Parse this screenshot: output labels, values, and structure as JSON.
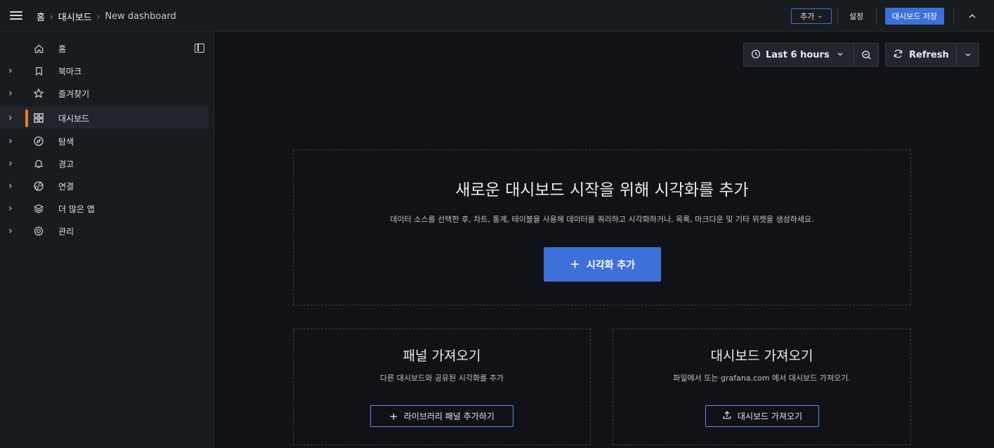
{
  "topbar": {
    "breadcrumbs": [
      "홈",
      "대시보드",
      "New dashboard"
    ],
    "add_label": "추가",
    "settings_label": "설정",
    "save_label": "대시보드 저장"
  },
  "sidebar": {
    "items": [
      {
        "label": "홈",
        "icon": "home-icon"
      },
      {
        "label": "북마크",
        "icon": "bookmark-icon"
      },
      {
        "label": "즐겨찾기",
        "icon": "star-icon"
      },
      {
        "label": "대시보드",
        "icon": "dashboard-grid-icon",
        "active": true
      },
      {
        "label": "탐색",
        "icon": "compass-icon"
      },
      {
        "label": "경고",
        "icon": "bell-icon"
      },
      {
        "label": "연결",
        "icon": "link-icon"
      },
      {
        "label": "더 많은 앱",
        "icon": "layers-icon"
      },
      {
        "label": "관리",
        "icon": "cog-icon"
      }
    ]
  },
  "toolbar": {
    "time_range": "Last 6 hours",
    "refresh_label": "Refresh"
  },
  "main": {
    "title": "새로운 대시보드 시작을 위해 시각화를 추가",
    "description": "데이터 소스를 선택한 후, 차트, 통계, 테이블을 사용해 데이터를 쿼리하고 시각화하거나, 목록, 마크다운 및 기타 위젯을 생성하세요.",
    "add_viz_label": "시각화 추가"
  },
  "import_panel": {
    "title": "패널 가져오기",
    "description": "다른 대시보드와 공유된 시각화를 추가",
    "button_label": "라이브러리 패널 추가하기"
  },
  "import_dashboard": {
    "title": "대시보드 가져오기",
    "description": "파일에서 또는 grafana.com 에서 대시보드 가져오기.",
    "button_label": "대시보드 가져오기"
  },
  "colors": {
    "accent": "#3d71d9",
    "active_indicator": "#ff7a1a",
    "background": "#111217",
    "panel": "#181b1f"
  }
}
